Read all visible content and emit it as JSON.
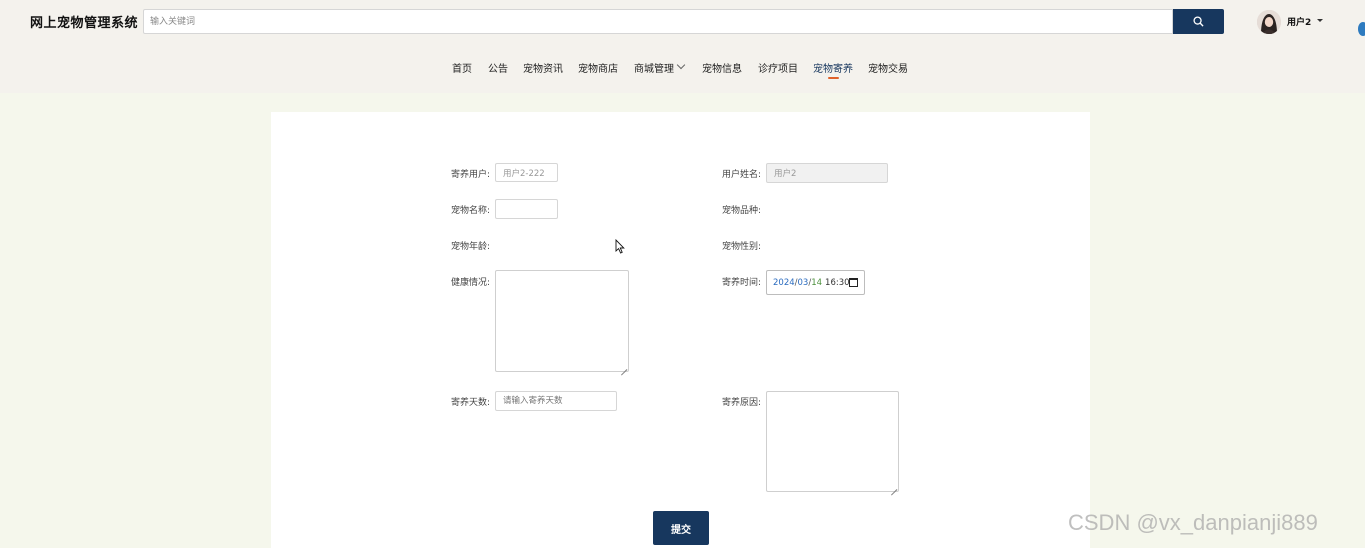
{
  "header": {
    "site_title": "网上宠物管理系统",
    "search_placeholder": "输入关键词",
    "user_name": "用户2"
  },
  "nav": {
    "items": [
      "首页",
      "公告",
      "宠物资讯",
      "宠物商店",
      "商城管理",
      "宠物信息",
      "诊疗项目",
      "宠物寄养",
      "宠物交易"
    ],
    "active": "宠物寄养"
  },
  "form": {
    "boarding_user_label": "寄养用户:",
    "boarding_user_value": "用户2-222",
    "user_name_label": "用户姓名:",
    "user_name_value": "用户2",
    "pet_name_label": "宠物名称:",
    "pet_breed_label": "宠物品种:",
    "pet_age_label": "宠物年龄:",
    "pet_gender_label": "宠物性别:",
    "health_label": "健康情况:",
    "boarding_time_label": "寄养时间:",
    "boarding_time": {
      "year": "2024",
      "month": "03",
      "day": "14",
      "time": "16:30"
    },
    "boarding_days_label": "寄养天数:",
    "boarding_days_placeholder": "请输入寄养天数",
    "boarding_reason_label": "寄养原因:",
    "submit_label": "提交"
  },
  "watermark": "CSDN @vx_danpianji889",
  "colors": {
    "primary": "#17375e",
    "accent": "#e0622b",
    "page_bg": "#f5f7ec",
    "header_bg": "#f4f2ed"
  }
}
